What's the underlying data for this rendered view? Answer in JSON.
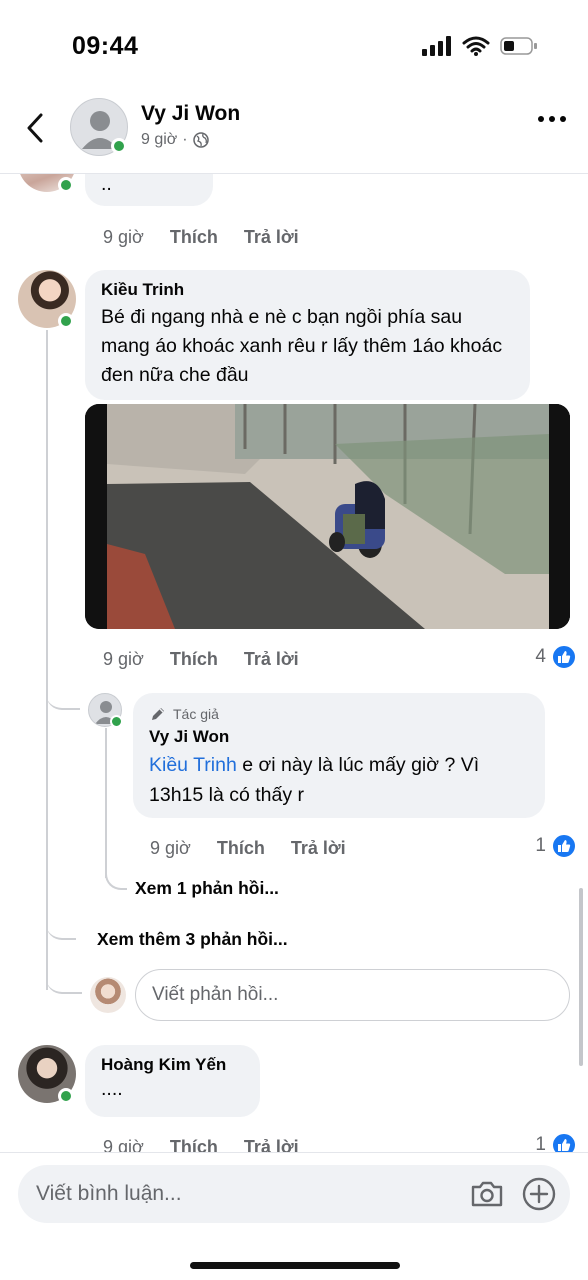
{
  "status": {
    "time": "09:44"
  },
  "header": {
    "name": "Vy Ji Won",
    "time": "9 giờ",
    "separator": "·"
  },
  "comments": [
    {
      "text": "..",
      "time": "9 giờ",
      "like": "Thích",
      "reply": "Trả lời"
    },
    {
      "author": "Kiều Trinh",
      "text": "Bé đi ngang nhà e nè c bạn ngồi phía sau mang áo khoác xanh rêu r lấy thêm 1áo khoác đen nữa che đầu",
      "time": "9 giờ",
      "like": "Thích",
      "reply": "Trả lời",
      "reactions": "4",
      "reply_item": {
        "badge": "Tác giả",
        "author": "Vy Ji Won",
        "mention": "Kiều Trinh",
        "text": " e ơi này là lúc mấy giờ   ? Vì 13h15 là có thấy r",
        "time": "9 giờ",
        "like": "Thích",
        "reply": "Trả lời",
        "reactions": "1",
        "view_replies": "Xem 1 phản hồi..."
      },
      "view_more": "Xem thêm 3 phản hồi...",
      "reply_placeholder": "Viết phản hồi..."
    },
    {
      "author": "Hoàng Kim Yến",
      "text": "....",
      "time": "9 giờ",
      "like": "Thích",
      "reply": "Trả lời",
      "reactions": "1"
    }
  ],
  "composer": {
    "placeholder": "Viết bình luận..."
  },
  "icons": [
    "back-arrow-icon",
    "globe-icon",
    "more-icon",
    "like-icon",
    "pencil-icon",
    "camera-icon",
    "plus-icon"
  ],
  "colors": {
    "accent": "#1877f2",
    "online": "#31a24c",
    "bubble": "#f0f2f5"
  }
}
